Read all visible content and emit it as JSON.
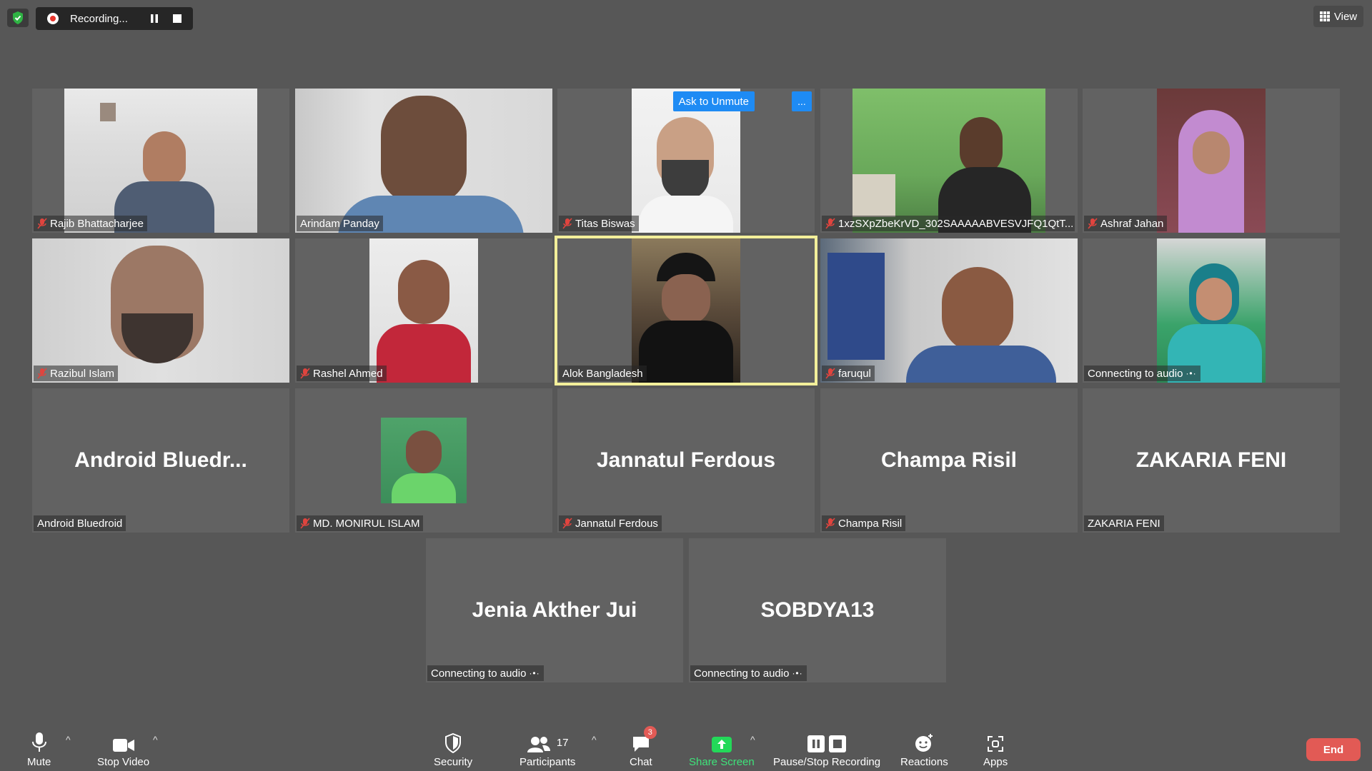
{
  "topbar": {
    "recording_label": "Recording...",
    "view_label": "View"
  },
  "tiles": [
    {
      "name": "Rajib Bhattacharjee",
      "muted": true
    },
    {
      "name": "Arindam Panday",
      "muted": false
    },
    {
      "name": "Titas Biswas",
      "muted": true,
      "ask_label": "Ask to Unmute",
      "more_label": "..."
    },
    {
      "name": "1xzSXpZbeKrVD_302SAAAAABVESVJFQ1QtT...",
      "muted": true
    },
    {
      "name": "Ashraf Jahan",
      "muted": true
    },
    {
      "name": "Razibul Islam",
      "muted": true
    },
    {
      "name": "Rashel Ahmed",
      "muted": true
    },
    {
      "name": "Alok Bangladesh",
      "muted": false,
      "active": true
    },
    {
      "name": "faruqul",
      "muted": true
    },
    {
      "name": "Connecting to audio",
      "muted": false
    },
    {
      "name": "Android Bluedroid",
      "big": "Android  Bluedr...",
      "muted": false
    },
    {
      "name": "MD. MONIRUL ISLAM",
      "muted": true
    },
    {
      "name": "Jannatul Ferdous",
      "big": "Jannatul Ferdous",
      "muted": true
    },
    {
      "name": "Champa Risil",
      "big": "Champa Risil",
      "muted": true
    },
    {
      "name": "ZAKARIA FENI",
      "big": "ZAKARIA FENI",
      "muted": false
    },
    {
      "name": "Connecting to audio",
      "big": "Jenia Akther Jui",
      "muted": false
    },
    {
      "name": "Connecting to audio",
      "big": "SOBDYA13",
      "muted": false
    }
  ],
  "toolbar": {
    "mute": "Mute",
    "stop_video": "Stop Video",
    "security": "Security",
    "participants": "Participants",
    "participants_count": "17",
    "chat": "Chat",
    "chat_badge": "3",
    "share_screen": "Share Screen",
    "recording": "Pause/Stop Recording",
    "reactions": "Reactions",
    "apps": "Apps",
    "end": "End"
  },
  "colors": {
    "background": "#575757",
    "tile": "#626262",
    "share_green": "#23d959",
    "end_red": "#e25a55",
    "accent_blue": "#1e8bf4",
    "active_speaker": "#f3ef9a"
  }
}
